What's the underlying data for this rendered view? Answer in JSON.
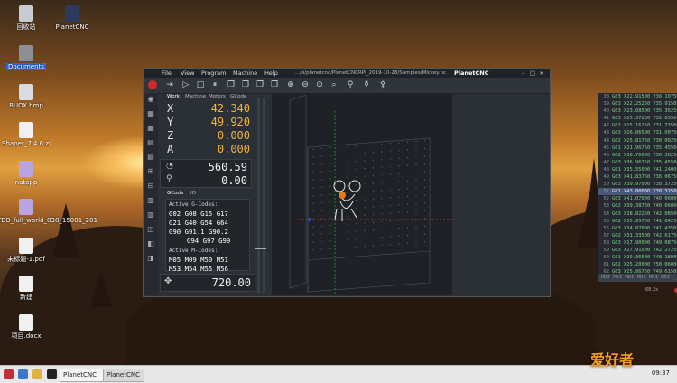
{
  "desktop": {
    "icons": [
      {
        "label": "回收站",
        "icon": "trash-icon"
      },
      {
        "label": "PlanetCNC",
        "icon": "planetcnc-icon"
      },
      {
        "label": "Documents",
        "icon": "folder-icon"
      },
      {
        "label": "BUOX.bmp",
        "icon": "image-icon"
      },
      {
        "label": "Shaper_7.4.6.zi",
        "icon": "file-icon"
      },
      {
        "label": "natapp",
        "icon": "app-icon"
      },
      {
        "label": "TDB_full_world_838_15081_201",
        "icon": "app-icon"
      },
      {
        "label": "未标题-1.pdf",
        "icon": "pdf-icon"
      },
      {
        "label": "新建",
        "icon": "doc-icon"
      },
      {
        "label": "项目.docx",
        "icon": "doc-icon"
      }
    ]
  },
  "taskbar": {
    "buttons": [
      "PlanetCNC",
      "PlanetCNC"
    ],
    "clock": "09:37",
    "watermark": "爱好者"
  },
  "window": {
    "title": "PlanetCNC",
    "path": "...pi/planetcnc/PlanetCNCRPI_2019-10-28/Samples/Mickey.nc",
    "menu": [
      "File",
      "View",
      "Program",
      "Machine",
      "Help"
    ]
  },
  "tabs": {
    "top": [
      "Work",
      "Machine",
      "Motors",
      "GCode"
    ],
    "bottom": [
      "GCode",
      "IO"
    ]
  },
  "axes": [
    {
      "label": "X",
      "value": "42.340"
    },
    {
      "label": "Y",
      "value": "49.920"
    },
    {
      "label": "Z",
      "value": "0.000"
    },
    {
      "label": "A",
      "value": "0.000"
    }
  ],
  "speed": {
    "value": "560.59"
  },
  "spindle": {
    "value": "0.00"
  },
  "gcodes": {
    "title": "Active G-Codes:",
    "lines": [
      "G02 G08 G15 G17",
      "G21 G40 G54 G64",
      "G90 G91.1 G90.2",
      "G94 G97 G99"
    ]
  },
  "mcodes": {
    "title": "Active M-Codes:",
    "lines": [
      "M05 M09 M50 M51",
      "M53 M54 M55 M56"
    ]
  },
  "jog": {
    "value": "720.00"
  },
  "gcode_panel": {
    "lines": [
      {
        "n": "38",
        "t": "G03 X22.91500 Y36.10750"
      },
      {
        "n": "39",
        "t": "G03 X22.25250 Y35.91500"
      },
      {
        "n": "40",
        "t": "G03 X23.08500 Y35.36250"
      },
      {
        "n": "41",
        "t": "G03 X25.37250 Y32.83500"
      },
      {
        "n": "42",
        "t": "G01 X25.16250 Y31.73500"
      },
      {
        "n": "43",
        "t": "G03 X26.06500 Y31.00750"
      },
      {
        "n": "44",
        "t": "G02 X25.81750 Y30.00250"
      },
      {
        "n": "45",
        "t": "G01 X21.96750 Y35.45500"
      },
      {
        "n": "46",
        "t": "G02 X36.76000 Y36.36250"
      },
      {
        "n": "47",
        "t": "G03 X36.96750 Y35.45500"
      },
      {
        "n": "48",
        "t": "G01 X35.55000 Y41.24000"
      },
      {
        "n": "49",
        "t": "G03 X41.83750 Y36.06750"
      },
      {
        "n": "50",
        "t": "G03 X39.97000 Y38.37250"
      },
      {
        "n": "51",
        "t": "G01 X43.00000 Y30.32500"
      },
      {
        "n": "52",
        "t": "G03 X41.07000 Y40.06000"
      },
      {
        "n": "53",
        "t": "G02 X39.38750 Y40.06000"
      },
      {
        "n": "54",
        "t": "G03 X38.82250 Y42.08500"
      },
      {
        "n": "55",
        "t": "G02 X35.95750 Y41.84250"
      },
      {
        "n": "56",
        "t": "G03 X34.87000 Y41.43500"
      },
      {
        "n": "57",
        "t": "G02 X31.33500 Y42.61750"
      },
      {
        "n": "58",
        "t": "G03 X17.90000 Y49.08750"
      },
      {
        "n": "59",
        "t": "G03 X27.91500 Y42.27250"
      },
      {
        "n": "60",
        "t": "G01 X29.36500 Y48.18000"
      },
      {
        "n": "61",
        "t": "G02 X25.20000 Y50.06000"
      },
      {
        "n": "62",
        "t": "G03 X25.06750 Y49.61500"
      },
      {
        "n": "63",
        "t": "G01 X26.33250 Y50.92500"
      },
      {
        "n": "64",
        "t": "G01 X25.40250 Y51.67000"
      },
      {
        "n": "65",
        "t": "G03 X25.23000 Y52.18250"
      }
    ],
    "highlight_index": 13,
    "mdi": "MDI MDI MDI MDI MDI MDI"
  },
  "statusbar": {
    "text": "68.2x"
  }
}
